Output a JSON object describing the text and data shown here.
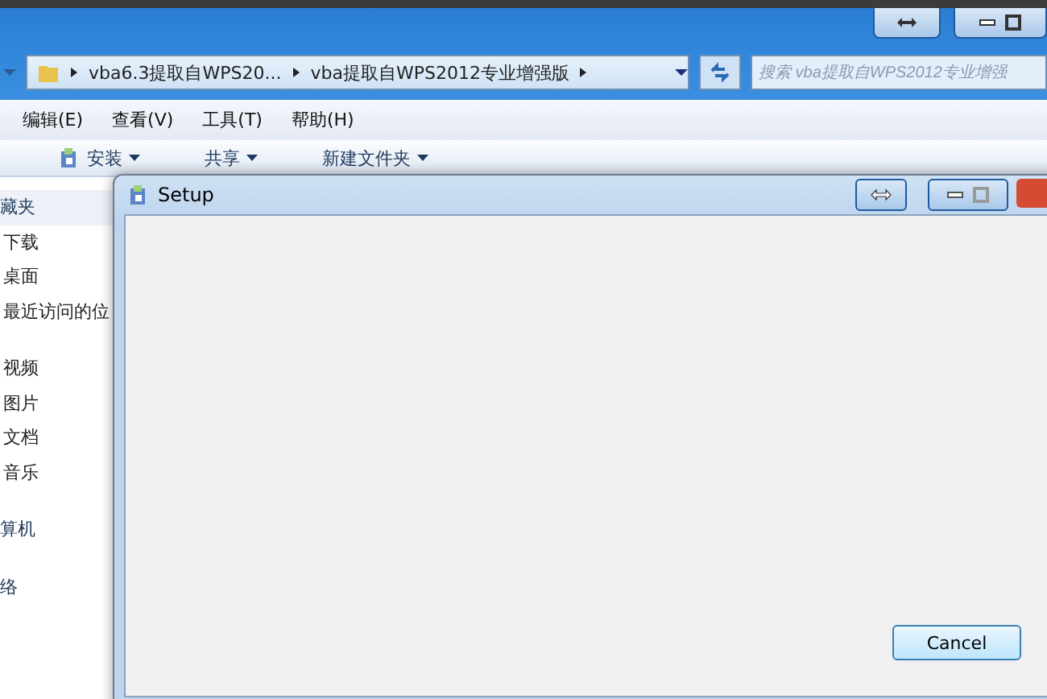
{
  "explorer": {
    "breadcrumbs": [
      "vba6.3提取自WPS20...",
      "vba提取自WPS2012专业增强版"
    ],
    "search": {
      "placeholder": "搜索 vba提取自WPS2012专业增强"
    },
    "menu": [
      "编辑(E)",
      "查看(V)",
      "工具(T)",
      "帮助(H)"
    ],
    "toolbar": [
      "安装",
      "共享",
      "新建文件夹"
    ],
    "nav": [
      {
        "kind": "group",
        "label": "藏夹"
      },
      {
        "kind": "item",
        "label": "下载"
      },
      {
        "kind": "item",
        "label": "桌面"
      },
      {
        "kind": "item",
        "label": "最近访问的位"
      },
      {
        "kind": "gap"
      },
      {
        "kind": "item",
        "label": "视频"
      },
      {
        "kind": "item",
        "label": "图片"
      },
      {
        "kind": "item",
        "label": "文档"
      },
      {
        "kind": "item",
        "label": "音乐"
      },
      {
        "kind": "gap"
      },
      {
        "kind": "group",
        "label": "算机"
      },
      {
        "kind": "gap"
      },
      {
        "kind": "group",
        "label": "络"
      }
    ]
  },
  "setup": {
    "title": "Setup",
    "buttons": [
      "Cancel"
    ]
  }
}
